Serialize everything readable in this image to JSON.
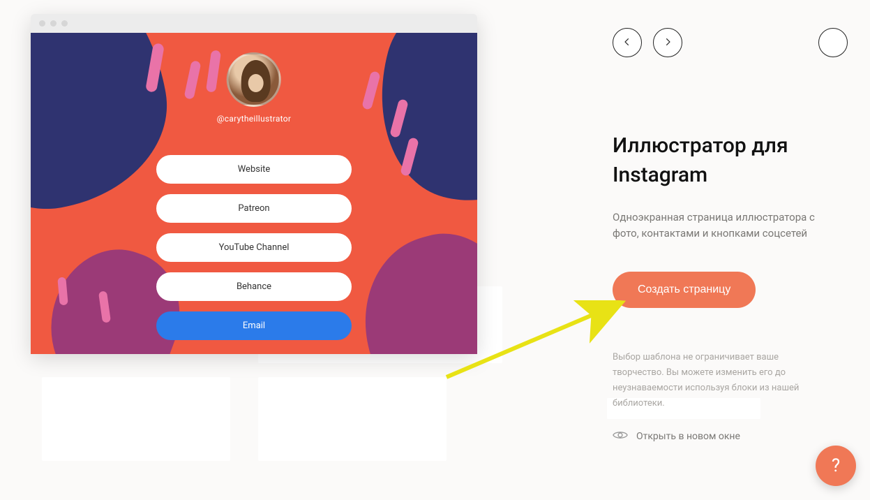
{
  "preview": {
    "handle": "@carytheillustrator",
    "links": [
      "Website",
      "Patreon",
      "YouTube Channel",
      "Behance",
      "Email"
    ]
  },
  "panel": {
    "title": "Иллюстратор для Instagram",
    "description": "Одноэкранная страница иллюстратора с фото, контактами и кнопками соцсетей",
    "cta": "Создать страницу",
    "note": "Выбор шаблона не ограничивает ваше творчество. Вы можете изменить его до неузнаваемости используя блоки из нашей библиотеки.",
    "open_new_window": "Открыть в новом окне"
  },
  "help": "?"
}
